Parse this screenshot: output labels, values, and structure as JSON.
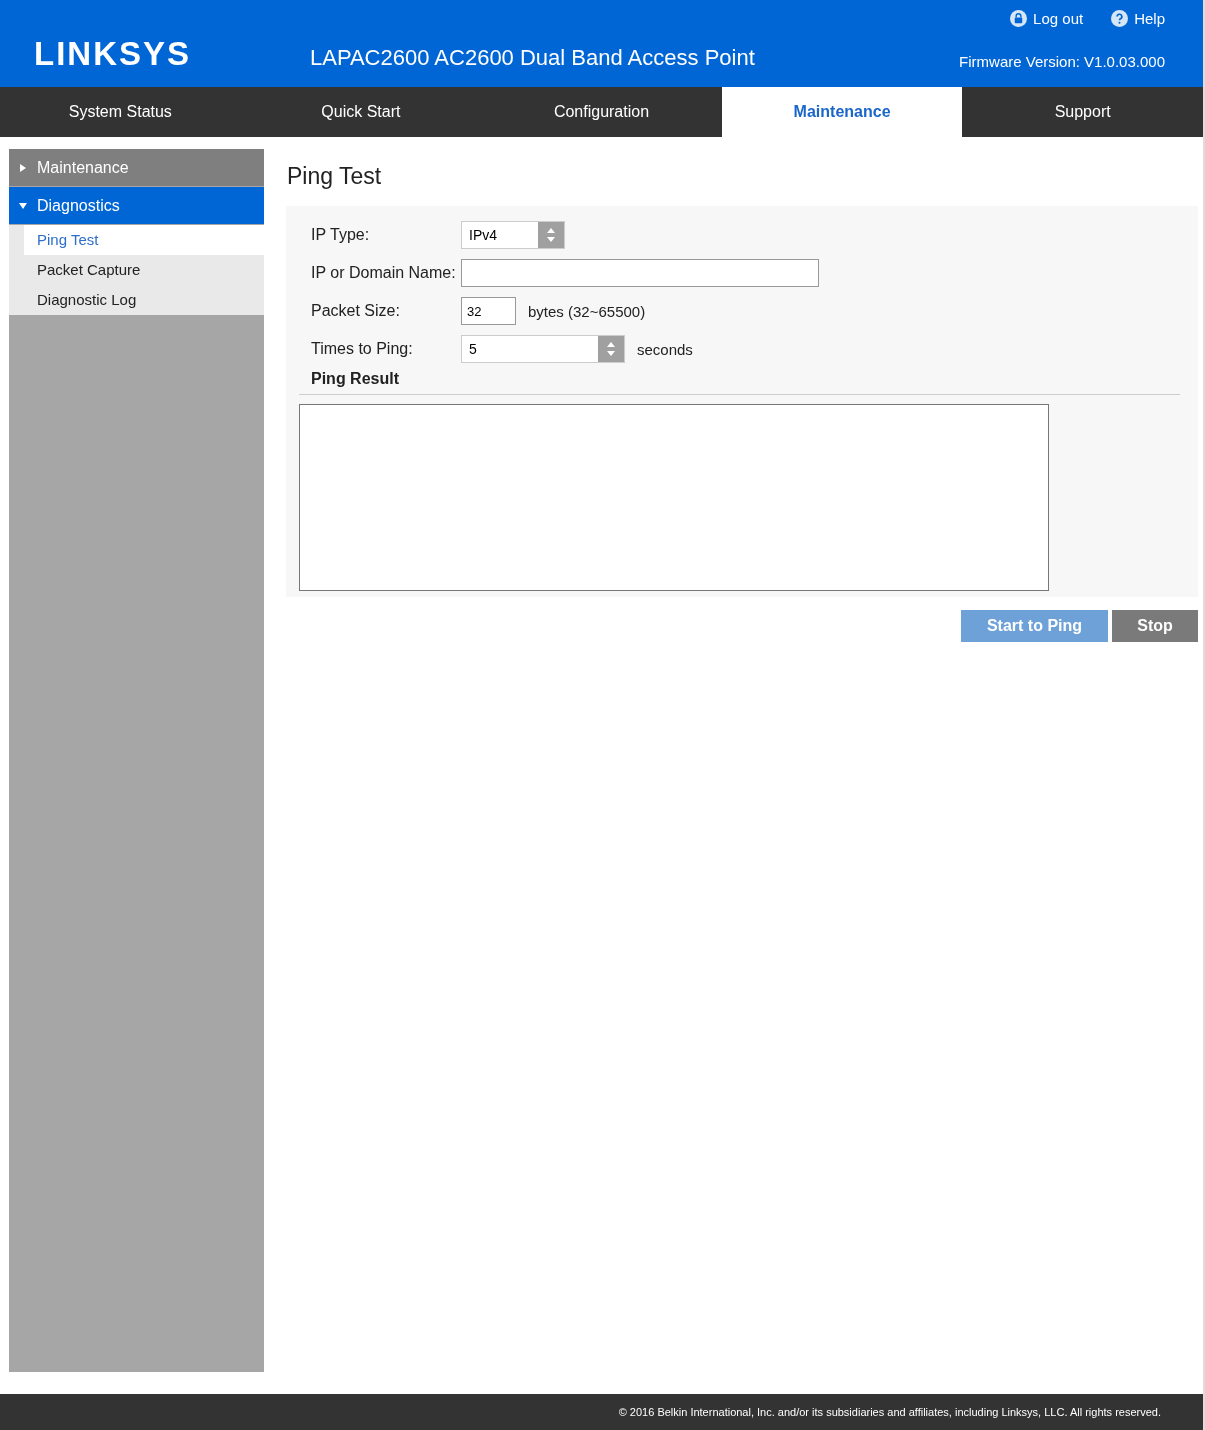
{
  "header": {
    "logo": "LINKSYS",
    "title": "LAPAC2600 AC2600 Dual Band Access Point",
    "links": [
      {
        "kind": "logout",
        "label": "Log out"
      },
      {
        "kind": "help",
        "label": "Help"
      }
    ],
    "firmware": "Firmware Version: V1.0.03.000"
  },
  "tabs": [
    {
      "label": "System Status",
      "selected": false
    },
    {
      "label": "Quick Start",
      "selected": false
    },
    {
      "label": "Configuration",
      "selected": false
    },
    {
      "label": "Maintenance",
      "selected": true
    },
    {
      "label": "Support",
      "selected": false
    }
  ],
  "sidebar": {
    "groups": [
      {
        "label": "Maintenance",
        "expanded": false
      },
      {
        "label": "Diagnostics",
        "expanded": true,
        "children": [
          {
            "label": "Ping Test",
            "selected": true
          },
          {
            "label": "Packet Capture",
            "selected": false
          },
          {
            "label": "Diagnostic Log",
            "selected": false
          }
        ]
      }
    ]
  },
  "page_title": "Ping Test",
  "form": {
    "ip_type": {
      "label": "IP Type:",
      "value": "IPv4"
    },
    "domain": {
      "label": "IP or Domain Name:"
    },
    "packet_size": {
      "label": "Packet Size:",
      "value": "32",
      "hint": "bytes (32~65500)"
    },
    "times": {
      "label": "Times to Ping:",
      "value": "5",
      "unit": "seconds"
    },
    "result_heading": "Ping Result"
  },
  "buttons": [
    {
      "kind": "primary",
      "label": "Start to Ping",
      "disabled": true
    },
    {
      "kind": "secondary",
      "label": "Stop"
    }
  ],
  "footer": "© 2016 Belkin International, Inc. and/or its subsidiaries and affiliates, including Linksys, LLC. All rights reserved."
}
